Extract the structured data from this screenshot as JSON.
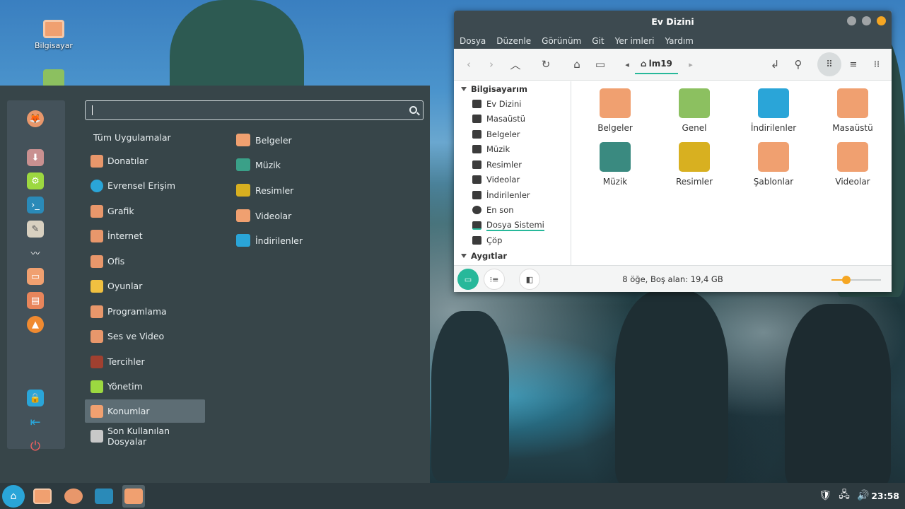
{
  "desktop": {
    "icons": [
      {
        "label": "Bilgisayar",
        "icon": "computer-icon"
      },
      {
        "label": "",
        "icon": "home-folder-icon"
      }
    ]
  },
  "menu": {
    "search": {
      "value": "",
      "placeholder": ""
    },
    "favorites": [
      "firefox-icon",
      "download-installer-icon",
      "settings-icon",
      "terminal-icon",
      "text-editor-icon",
      "audio-icon",
      "files-icon",
      "office-icon",
      "vlc-icon"
    ],
    "session": [
      "lock-screen-icon",
      "logout-icon",
      "power-icon"
    ],
    "all_apps_label": "Tüm Uygulamalar",
    "categories": [
      {
        "label": "Donatılar",
        "icon": "accessories-icon",
        "color": "#e8976b"
      },
      {
        "label": "Evrensel Erişim",
        "icon": "accessibility-icon",
        "color": "#2aa5d8"
      },
      {
        "label": "Grafik",
        "icon": "graphics-icon",
        "color": "#e8976b"
      },
      {
        "label": "İnternet",
        "icon": "internet-icon",
        "color": "#e8976b"
      },
      {
        "label": "Ofis",
        "icon": "office-icon",
        "color": "#e8976b"
      },
      {
        "label": "Oyunlar",
        "icon": "games-icon",
        "color": "#f0c040"
      },
      {
        "label": "Programlama",
        "icon": "programming-icon",
        "color": "#e8976b"
      },
      {
        "label": "Ses ve Video",
        "icon": "multimedia-icon",
        "color": "#e8976b"
      },
      {
        "label": "Tercihler",
        "icon": "preferences-icon",
        "color": "#a04030"
      },
      {
        "label": "Yönetim",
        "icon": "administration-icon",
        "color": "#9cd840"
      },
      {
        "label": "Konumlar",
        "icon": "places-icon",
        "color": "#f0a070"
      },
      {
        "label": "Son Kullanılan Dosyalar",
        "icon": "recent-files-icon",
        "color": "#c8c8c8"
      }
    ],
    "active_category": "Konumlar",
    "places": [
      {
        "label": "Belgeler",
        "icon": "documents-folder-icon",
        "color": "#f0a070"
      },
      {
        "label": "Müzik",
        "icon": "music-folder-icon",
        "color": "#3aa088"
      },
      {
        "label": "Resimler",
        "icon": "pictures-folder-icon",
        "color": "#d8b020"
      },
      {
        "label": "Videolar",
        "icon": "videos-folder-icon",
        "color": "#f0a070"
      },
      {
        "label": "İndirilenler",
        "icon": "downloads-folder-icon",
        "color": "#2aa5d8"
      }
    ]
  },
  "window": {
    "title": "Ev Dizini",
    "menubar": [
      "Dosya",
      "Düzenle",
      "Görünüm",
      "Git",
      "Yer imleri",
      "Yardım"
    ],
    "breadcrumb": "lm19",
    "sidebar": {
      "computer_header": "Bilgisayarım",
      "items": [
        {
          "label": "Ev Dizini",
          "icon": "home-icon"
        },
        {
          "label": "Masaüstü",
          "icon": "desktop-icon"
        },
        {
          "label": "Belgeler",
          "icon": "documents-icon"
        },
        {
          "label": "Müzik",
          "icon": "music-icon"
        },
        {
          "label": "Resimler",
          "icon": "pictures-icon"
        },
        {
          "label": "Videolar",
          "icon": "videos-icon"
        },
        {
          "label": "İndirilenler",
          "icon": "downloads-icon"
        },
        {
          "label": "En son",
          "icon": "recent-icon"
        },
        {
          "label": "Dosya Sistemi",
          "icon": "filesystem-icon"
        },
        {
          "label": "Çöp",
          "icon": "trash-icon"
        }
      ],
      "devices_header": "Aygıtlar"
    },
    "files": [
      {
        "name": "Belgeler",
        "icon": "documents-folder-icon",
        "color": "#f0a070"
      },
      {
        "name": "Genel",
        "icon": "public-folder-icon",
        "color": "#8cc060"
      },
      {
        "name": "İndirilenler",
        "icon": "downloads-folder-icon",
        "color": "#2aa5d8"
      },
      {
        "name": "Masaüstü",
        "icon": "desktop-folder-icon",
        "color": "#f0a070"
      },
      {
        "name": "Müzik",
        "icon": "music-folder-icon",
        "color": "#3a8a80"
      },
      {
        "name": "Resimler",
        "icon": "pictures-folder-icon",
        "color": "#d8b020"
      },
      {
        "name": "Şablonlar",
        "icon": "templates-folder-icon",
        "color": "#f0a070"
      },
      {
        "name": "Videolar",
        "icon": "videos-folder-icon",
        "color": "#f0a070"
      }
    ],
    "status": "8 öğe, Boş alan: 19,4 GB",
    "zoom_level": 0.3
  },
  "taskbar": {
    "apps": [
      "mint-menu-icon",
      "screenshot-app-icon",
      "firefox-icon",
      "terminal-icon",
      "files-icon"
    ],
    "tray": [
      "shield-icon",
      "network-icon",
      "volume-icon"
    ],
    "clock": "23:58"
  },
  "colors": {
    "accent": "#27b89a",
    "orange": "#f5a623",
    "menu_bg": "#374549",
    "titlebar_bg": "#3d4a50"
  }
}
